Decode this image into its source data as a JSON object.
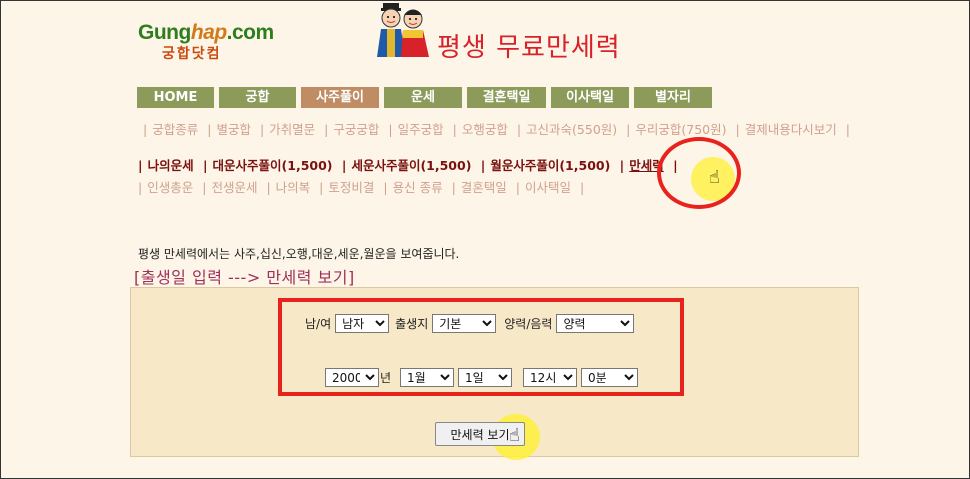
{
  "logo": {
    "main_a": "Gung",
    "main_b": "hap",
    "main_c": ".com",
    "sub": "궁합닷컴"
  },
  "site_title": "평생 무료만세력",
  "menu": [
    "HOME",
    "궁합",
    "사주풀이",
    "운세",
    "결혼택일",
    "이사택일",
    "별자리"
  ],
  "sublinks_row1": [
    "궁합종류",
    "별궁합",
    "가취멸문",
    "구궁궁합",
    "일주궁합",
    "오행궁합",
    "고신과숙(550원)",
    "우리궁합(750원)",
    "결제내용다시보기"
  ],
  "sublinks_row2": [
    "나의운세",
    "대운사주풀이(1,500)",
    "세운사주풀이(1,500)",
    "월운사주풀이(1,500)",
    "만세력"
  ],
  "sublinks_row3": [
    "인생총운",
    "전생운세",
    "나의복",
    "토정비결",
    "용신 종류",
    "결혼택일",
    "이사택일"
  ],
  "intro": "평생 만세력에서는 사주,십신,오행,대운,세운,월운을 보여줍니다.",
  "section_title": "[출생일 입력 ---> 만세력 보기]",
  "form": {
    "gender_label": "남/여",
    "gender_value": "남자",
    "birthplace_label": "출생지",
    "birthplace_value": "기본",
    "calendar_label": "양력/음력",
    "calendar_value": "양력",
    "year_value": "2000",
    "year_suffix": "년",
    "month_value": "1월",
    "day_value": "1일",
    "hour_value": "12시",
    "minute_value": "0분",
    "submit_label": "만세력 보기"
  },
  "colors": {
    "highlight_red": "#e8221c",
    "menu_green": "#8c9a5a",
    "menu_active": "#c08c64"
  }
}
